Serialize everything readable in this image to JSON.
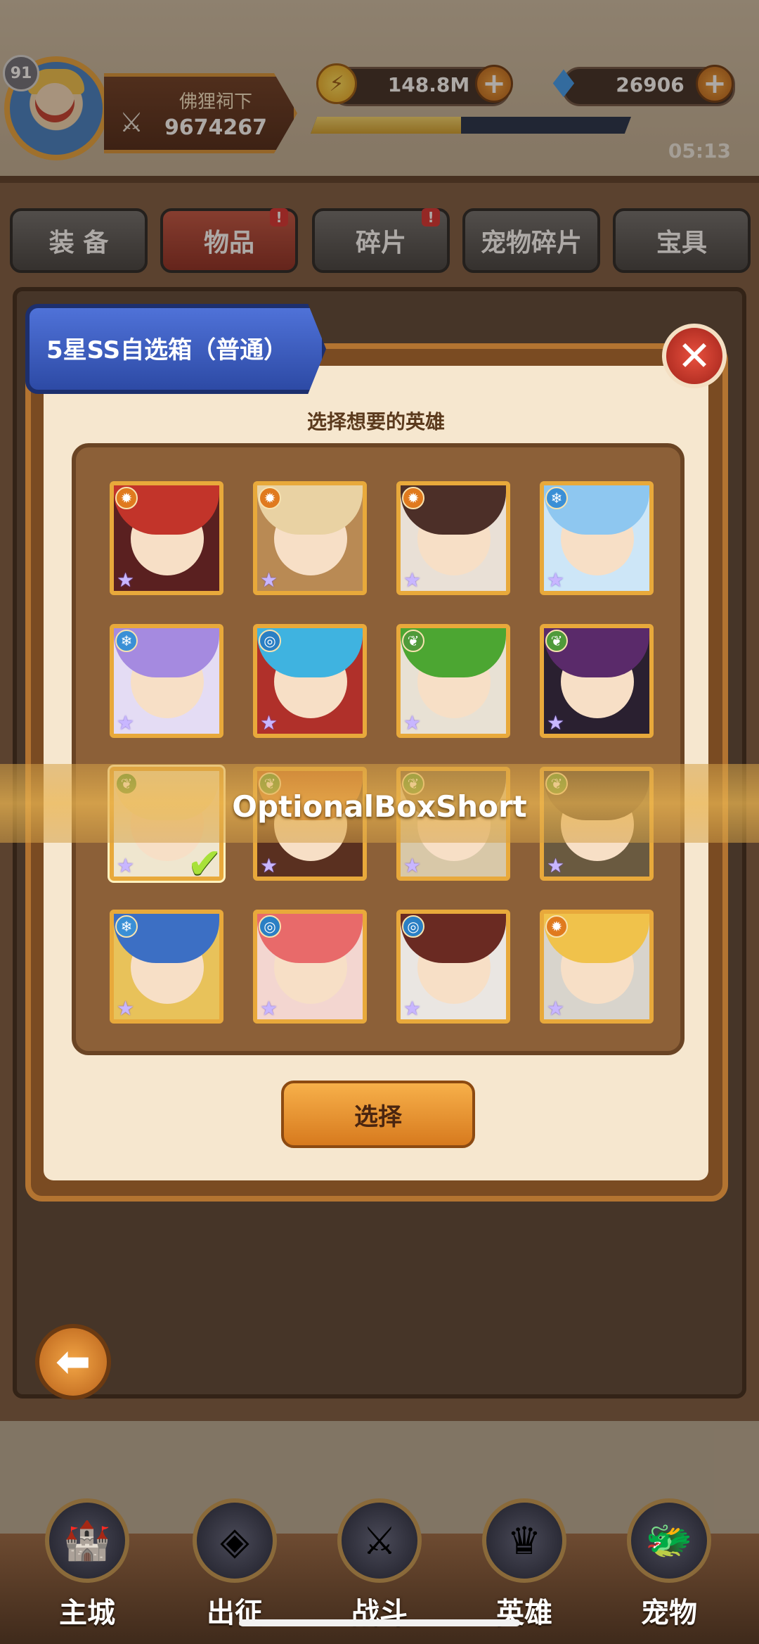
{
  "player": {
    "level": "91",
    "name": "佛狸祠下",
    "power": "9674267"
  },
  "resources": {
    "coins": "148.8M",
    "gems": "26906",
    "time": "05:13",
    "xp_progress": 0.47
  },
  "tabs": [
    {
      "label": "装 备",
      "badge": ""
    },
    {
      "label": "物品",
      "badge": "!"
    },
    {
      "label": "碎片",
      "badge": "!"
    },
    {
      "label": "宠物碎片",
      "badge": ""
    },
    {
      "label": "宝具",
      "badge": ""
    }
  ],
  "dialog": {
    "title": "5星SS自选箱（普通）",
    "subtitle": "选择想要的英雄",
    "close_icon": "close-icon",
    "select_label": "选择",
    "banner_text": "OptionalBoxShort"
  },
  "heroes": [
    {
      "element": "fire",
      "hair": "#c2342a",
      "bg": "#5a2020"
    },
    {
      "element": "fire",
      "hair": "#e9d2a3",
      "bg": "#b98a54"
    },
    {
      "element": "fire",
      "hair": "#4c2f28",
      "bg": "#e9e0d6"
    },
    {
      "element": "ice",
      "hair": "#8ec7f0",
      "bg": "#cde6f7"
    },
    {
      "element": "ice",
      "hair": "#a58ae0",
      "bg": "#e4dcf4"
    },
    {
      "element": "water",
      "hair": "#3fb3e0",
      "bg": "#b0302a"
    },
    {
      "element": "nature",
      "hair": "#4ca632",
      "bg": "#e8e1d4"
    },
    {
      "element": "nature",
      "hair": "#5a2a6a",
      "bg": "#2a2030"
    },
    {
      "element": "nature",
      "hair": "#f3e2b3",
      "bg": "#efe6cf"
    },
    {
      "element": "nature",
      "hair": "#c86a2a",
      "bg": "#5a3020"
    },
    {
      "element": "nature",
      "hair": "#7a6040",
      "bg": "#d8c8a8"
    },
    {
      "element": "nature",
      "hair": "#4a3a30",
      "bg": "#6a5a40"
    },
    {
      "element": "ice",
      "hair": "#3c6fc4",
      "bg": "#e8c25a"
    },
    {
      "element": "water",
      "hair": "#e86a6a",
      "bg": "#f3d6d0"
    },
    {
      "element": "water",
      "hair": "#6a2a22",
      "bg": "#eae6e2"
    },
    {
      "element": "fire",
      "hair": "#f0c24b",
      "bg": "#d8d4cc"
    }
  ],
  "selected_index": 8,
  "nav": [
    {
      "label": "主城",
      "icon": "castle-icon"
    },
    {
      "label": "出征",
      "icon": "expedition-icon"
    },
    {
      "label": "战斗",
      "icon": "battle-icon"
    },
    {
      "label": "英雄",
      "icon": "hero-icon"
    },
    {
      "label": "宠物",
      "icon": "pet-icon"
    }
  ],
  "colors": {
    "fire": "#e07a1e",
    "ice": "#3a8fd6",
    "water": "#2a7fc4",
    "nature": "#4f9a3a",
    "frame": "#e8a93b"
  }
}
